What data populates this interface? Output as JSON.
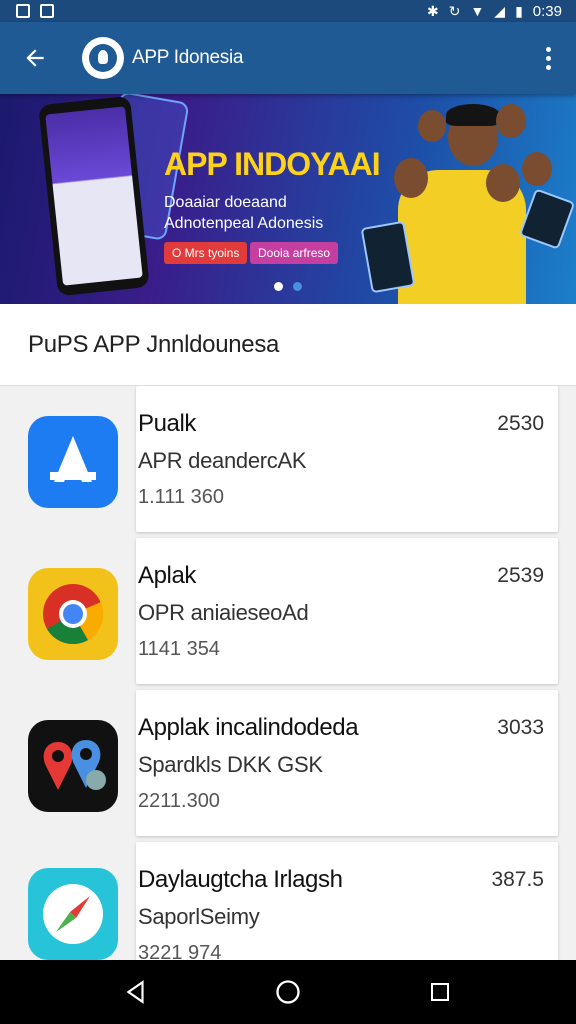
{
  "status_bar": {
    "time": "0:39"
  },
  "app_bar": {
    "title": "APP Idonesia"
  },
  "banner": {
    "headline": "APP INDOYAAI",
    "line1": "Doaaiar doeaand",
    "line2": "Adnotenpeal Adonesis",
    "button1": "O Mrs tyoins",
    "button2": "Dooia arfreso",
    "pages": 2,
    "active_page": 0
  },
  "section": {
    "title": "PuPS APP Jnnldounesa"
  },
  "apps": [
    {
      "name": "Pualk",
      "subtitle": "APR deandercAK",
      "meta": "1.111 360",
      "count": "2530",
      "icon": "app-store-icon",
      "color": "#1e7cf2"
    },
    {
      "name": "Aplak",
      "subtitle": "OPR aniaieseoAd",
      "meta": "1141 354",
      "count": "2539",
      "icon": "chrome-icon",
      "color": "#f2c21b"
    },
    {
      "name": "Applak incalindodeda",
      "subtitle": "Spardkls DKK GSK",
      "meta": "2211.300",
      "count": "3033",
      "icon": "maps-pin-icon",
      "color": "#111111"
    },
    {
      "name": "Daylaugtcha Irlagsh",
      "subtitle": "SaporlSeimy",
      "meta": "3221 974",
      "count": "387.5",
      "icon": "compass-icon",
      "color": "#27c3d8"
    }
  ],
  "colors": {
    "status_bar": "#1c4a7c",
    "app_bar": "#1f5a94",
    "accent_yellow": "#ffd21a"
  }
}
